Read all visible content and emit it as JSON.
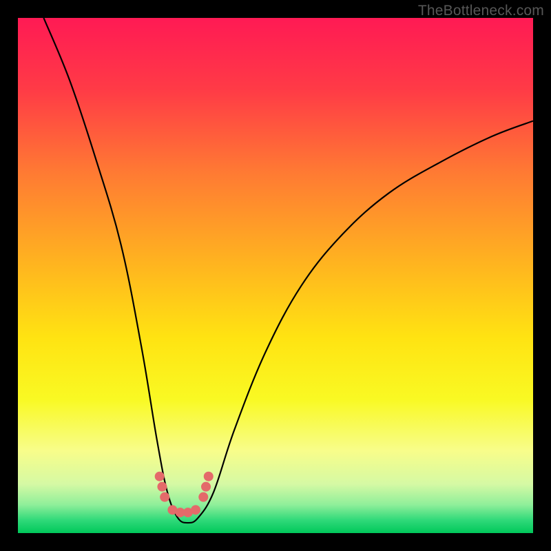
{
  "watermark": "TheBottleneck.com",
  "chart_data": {
    "type": "line",
    "title": "",
    "xlabel": "",
    "ylabel": "",
    "xlim": [
      0,
      100
    ],
    "ylim": [
      0,
      100
    ],
    "series": [
      {
        "name": "bottleneck-curve",
        "x": [
          5,
          10,
          15,
          20,
          24,
          27,
          29,
          31,
          33,
          35,
          38,
          42,
          48,
          55,
          63,
          72,
          82,
          92,
          100
        ],
        "values": [
          100,
          88,
          73,
          56,
          36,
          18,
          8,
          3,
          2,
          3,
          8,
          20,
          35,
          48,
          58,
          66,
          72,
          77,
          80
        ]
      }
    ],
    "markers": {
      "name": "highlight-dots",
      "x": [
        27.5,
        28.0,
        28.5,
        30.0,
        31.5,
        33.0,
        34.5,
        36.0,
        36.5,
        37.0
      ],
      "values": [
        11.0,
        9.0,
        7.0,
        4.5,
        4.0,
        4.0,
        4.5,
        7.0,
        9.0,
        11.0
      ],
      "color": "#e46a6a",
      "radius_px": 7
    },
    "gradient_stops": [
      {
        "offset": 0.0,
        "color": "#ff1a54"
      },
      {
        "offset": 0.14,
        "color": "#ff3b46"
      },
      {
        "offset": 0.3,
        "color": "#ff7a33"
      },
      {
        "offset": 0.48,
        "color": "#ffb51f"
      },
      {
        "offset": 0.62,
        "color": "#ffe312"
      },
      {
        "offset": 0.74,
        "color": "#f9f923"
      },
      {
        "offset": 0.84,
        "color": "#f8fd8a"
      },
      {
        "offset": 0.905,
        "color": "#d5f9a4"
      },
      {
        "offset": 0.945,
        "color": "#8fef9a"
      },
      {
        "offset": 0.975,
        "color": "#2fd979"
      },
      {
        "offset": 1.0,
        "color": "#00c85a"
      }
    ]
  }
}
